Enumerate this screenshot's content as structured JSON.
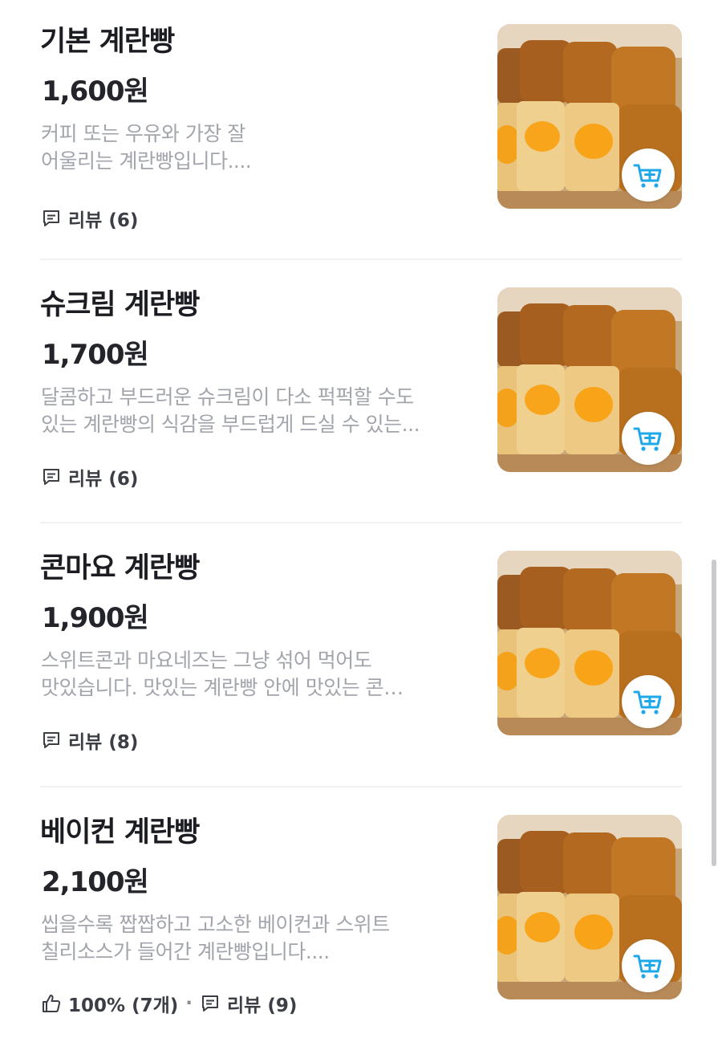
{
  "accent_color": "#1fa8e8",
  "items": [
    {
      "name": "기본 계란빵",
      "price": "1,600원",
      "desc": [
        "커피 또는 우유와 가장 잘",
        "어울리는 계란빵입니다...."
      ],
      "review_label": "리뷰 (6)",
      "like_label": "",
      "icons": {
        "review": "comment-icon",
        "cart": "cart-add-icon"
      }
    },
    {
      "name": "슈크림 계란빵",
      "price": "1,700원",
      "desc": [
        "달콤하고 부드러운 슈크림이 다소 퍽퍽할 수도",
        "있는 계란빵의 식감을 부드럽게 드실 수 있는..."
      ],
      "review_label": "리뷰 (6)",
      "like_label": "",
      "icons": {
        "review": "comment-icon",
        "cart": "cart-add-icon"
      }
    },
    {
      "name": "콘마요 계란빵",
      "price": "1,900원",
      "desc": [
        "스위트콘과 마요네즈는 그냥 섞어 먹어도",
        "맛있습니다. 맛있는 계란빵 안에 맛있는 콘…"
      ],
      "review_label": "리뷰 (8)",
      "like_label": "",
      "icons": {
        "review": "comment-icon",
        "cart": "cart-add-icon"
      }
    },
    {
      "name": "베이컨 계란빵",
      "price": "2,100원",
      "desc": [
        "씹을수록 짭짭하고 고소한 베이컨과 스위트",
        "칠리소스가 들어간 계란빵입니다...."
      ],
      "review_label": "리뷰 (9)",
      "like_label": "100% (7개)",
      "separator": "·",
      "icons": {
        "like": "thumbs-up-icon",
        "review": "comment-icon",
        "cart": "cart-add-icon"
      }
    }
  ]
}
